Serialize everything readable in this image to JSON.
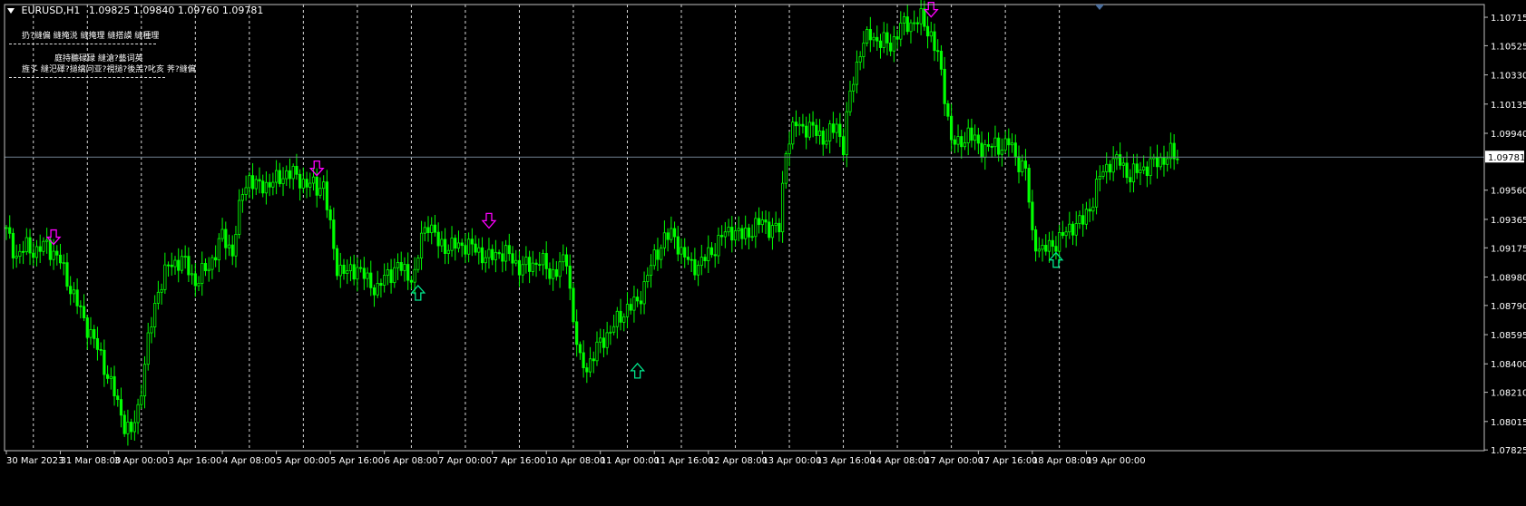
{
  "header": {
    "symbol": "EURUSD,H1",
    "ohlc": "1.09825 1.09840 1.09760 1.09781"
  },
  "indicator_text": {
    "line1": "扔?縫偏 縫掩涚 縫掩理 縫搭謨 縫種理",
    "line2": "庭持聽碌碌 縫滄?藝词英",
    "line3": "旌孓 縫汜礋?搥缡问亚?視搥?後羔?叱亥 荠?縫偏"
  },
  "colors": {
    "background": "#000000",
    "candle": "#00ff00",
    "grid": "#ffffff",
    "axis": "#c0c0c0",
    "price_line": "#708090",
    "down_arrow": "#ff00ff",
    "up_arrow": "#00e68c"
  },
  "chart_data": {
    "type": "candlestick",
    "symbol": "EURUSD",
    "timeframe": "H1",
    "ylim": [
      1.0782,
      1.108
    ],
    "grid": true,
    "y_ticks": [
      "1.10715",
      "1.10525",
      "1.10330",
      "1.10135",
      "1.09940",
      "1.09560",
      "1.09365",
      "1.09175",
      "1.08980",
      "1.08790",
      "1.08595",
      "1.08400",
      "1.08210",
      "1.08015",
      "1.07825"
    ],
    "x_ticks": [
      "30 Mar 2023",
      "31 Mar 08:00",
      "3 Apr 00:00",
      "3 Apr 16:00",
      "4 Apr 08:00",
      "5 Apr 00:00",
      "5 Apr 16:00",
      "6 Apr 08:00",
      "7 Apr 00:00",
      "7 Apr 16:00",
      "10 Apr 08:00",
      "11 Apr 00:00",
      "11 Apr 16:00",
      "12 Apr 08:00",
      "13 Apr 00:00",
      "13 Apr 16:00",
      "14 Apr 08:00",
      "17 Apr 00:00",
      "17 Apr 16:00",
      "18 Apr 08:00",
      "19 Apr 00:00"
    ],
    "grid_hours": [
      8,
      24,
      40,
      56,
      72,
      88,
      104,
      120,
      136,
      152,
      168,
      184,
      200,
      216,
      232,
      248,
      264,
      280,
      296,
      312
    ],
    "current_price": "1.09781",
    "price_points": [
      [
        0,
        1.0928
      ],
      [
        3,
        1.0912
      ],
      [
        6,
        1.0918
      ],
      [
        9,
        1.0915
      ],
      [
        12,
        1.092
      ],
      [
        16,
        1.0908
      ],
      [
        20,
        1.0885
      ],
      [
        24,
        1.0865
      ],
      [
        28,
        1.0845
      ],
      [
        32,
        1.082
      ],
      [
        35,
        1.08
      ],
      [
        37,
        1.0793
      ],
      [
        39,
        1.081
      ],
      [
        42,
        1.0855
      ],
      [
        45,
        1.089
      ],
      [
        48,
        1.0905
      ],
      [
        52,
        1.091
      ],
      [
        56,
        1.0895
      ],
      [
        60,
        1.0905
      ],
      [
        64,
        1.0925
      ],
      [
        67,
        1.0915
      ],
      [
        70,
        1.0955
      ],
      [
        72,
        1.0965
      ],
      [
        74,
        1.0958
      ],
      [
        77,
        1.096
      ],
      [
        80,
        1.0962
      ],
      [
        83,
        1.0968
      ],
      [
        86,
        1.0965
      ],
      [
        89,
        1.096
      ],
      [
        92,
        1.0958
      ],
      [
        94,
        1.096
      ],
      [
        96,
        1.093
      ],
      [
        98,
        1.0905
      ],
      [
        101,
        1.09
      ],
      [
        104,
        1.0905
      ],
      [
        107,
        1.0895
      ],
      [
        110,
        1.089
      ],
      [
        113,
        1.09
      ],
      [
        116,
        1.0905
      ],
      [
        119,
        1.09
      ],
      [
        121,
        1.0898
      ],
      [
        123,
        1.0925
      ],
      [
        125,
        1.0935
      ],
      [
        128,
        1.092
      ],
      [
        132,
        1.0918
      ],
      [
        136,
        1.092
      ],
      [
        140,
        1.0915
      ],
      [
        143,
        1.091
      ],
      [
        146,
        1.0915
      ],
      [
        149,
        1.0912
      ],
      [
        152,
        1.0905
      ],
      [
        155,
        1.0905
      ],
      [
        158,
        1.091
      ],
      [
        161,
        1.09
      ],
      [
        164,
        1.0905
      ],
      [
        166,
        1.091
      ],
      [
        168,
        1.087
      ],
      [
        170,
        1.084
      ],
      [
        172,
        1.0838
      ],
      [
        175,
        1.085
      ],
      [
        178,
        1.086
      ],
      [
        181,
        1.0868
      ],
      [
        184,
        1.0878
      ],
      [
        187,
        1.088
      ],
      [
        190,
        1.09
      ],
      [
        193,
        1.0915
      ],
      [
        195,
        1.0925
      ],
      [
        198,
        1.0925
      ],
      [
        200,
        1.0915
      ],
      [
        203,
        1.0905
      ],
      [
        206,
        1.0908
      ],
      [
        209,
        1.0915
      ],
      [
        212,
        1.0925
      ],
      [
        215,
        1.093
      ],
      [
        218,
        1.0925
      ],
      [
        221,
        1.093
      ],
      [
        224,
        1.0935
      ],
      [
        227,
        1.093
      ],
      [
        229,
        1.093
      ],
      [
        231,
        1.0985
      ],
      [
        234,
        1.1
      ],
      [
        237,
        1.0998
      ],
      [
        240,
        1.0995
      ],
      [
        243,
        1.099
      ],
      [
        246,
        1.1
      ],
      [
        248,
        1.0985
      ],
      [
        250,
        1.102
      ],
      [
        253,
        1.105
      ],
      [
        256,
        1.106
      ],
      [
        259,
        1.1055
      ],
      [
        262,
        1.1053
      ],
      [
        265,
        1.1065
      ],
      [
        268,
        1.1068
      ],
      [
        271,
        1.107
      ],
      [
        274,
        1.106
      ],
      [
        276,
        1.1045
      ],
      [
        278,
        1.102
      ],
      [
        280,
        1.099
      ],
      [
        282,
        1.0985
      ],
      [
        285,
        1.0995
      ],
      [
        288,
        1.0985
      ],
      [
        291,
        1.0985
      ],
      [
        294,
        1.0985
      ],
      [
        297,
        1.0988
      ],
      [
        299,
        1.0978
      ],
      [
        302,
        1.097
      ],
      [
        304,
        1.0925
      ],
      [
        307,
        1.0915
      ],
      [
        310,
        1.092
      ],
      [
        313,
        1.0925
      ],
      [
        316,
        1.0933
      ],
      [
        319,
        1.0935
      ],
      [
        322,
        1.095
      ],
      [
        324,
        1.0965
      ],
      [
        327,
        1.0975
      ],
      [
        330,
        1.0975
      ],
      [
        333,
        1.0965
      ],
      [
        336,
        1.097
      ],
      [
        339,
        1.0973
      ],
      [
        342,
        1.0976
      ],
      [
        345,
        1.098
      ],
      [
        347,
        1.0978
      ]
    ],
    "signals": [
      {
        "type": "down",
        "hour": 14,
        "price": 1.0924
      },
      {
        "type": "down",
        "hour": 92,
        "price": 1.097
      },
      {
        "type": "down",
        "hour": 143,
        "price": 1.0935
      },
      {
        "type": "down",
        "hour": 274,
        "price": 1.1076
      },
      {
        "type": "up",
        "hour": 122,
        "price": 1.0888
      },
      {
        "type": "up",
        "hour": 187,
        "price": 1.0836
      },
      {
        "type": "up",
        "hour": 311,
        "price": 1.091
      }
    ]
  }
}
